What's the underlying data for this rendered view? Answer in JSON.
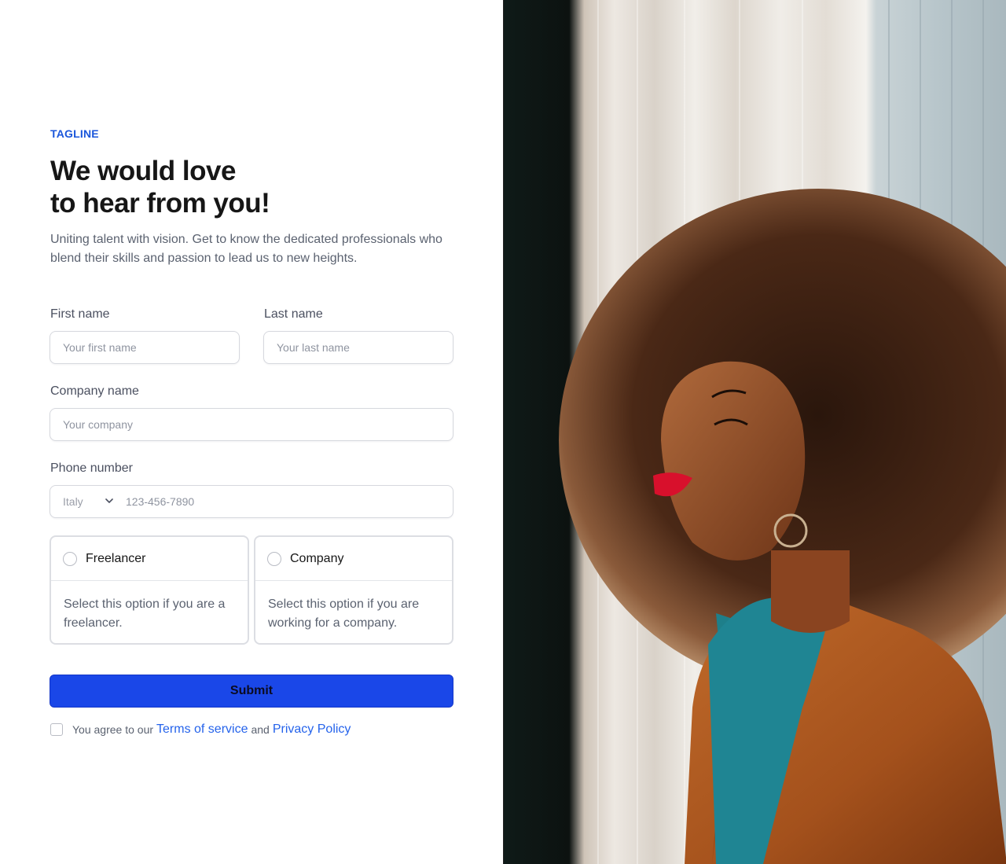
{
  "colors": {
    "accent": "#1a56db",
    "button": "#1a47e8",
    "link": "#2563eb"
  },
  "hero": {
    "tagline": "TAGLINE",
    "title_line1": "We would love",
    "title_line2": "to hear from you!",
    "subtitle": "Uniting talent with vision. Get to know the dedicated professionals who blend their skills and passion to lead us to new heights."
  },
  "form": {
    "first_name": {
      "label": "First name",
      "placeholder": "Your first name",
      "value": ""
    },
    "last_name": {
      "label": "Last name",
      "placeholder": "Your last name",
      "value": ""
    },
    "company": {
      "label": "Company name",
      "placeholder": "Your company",
      "value": ""
    },
    "phone": {
      "label": "Phone number",
      "country": "Italy",
      "placeholder": "123-456-7890",
      "value": ""
    },
    "options": [
      {
        "name": "Freelancer",
        "description": "Select this option if you are a freelancer.",
        "selected": false
      },
      {
        "name": "Company",
        "description": "Select this option if you are working for a company.",
        "selected": false
      }
    ],
    "submit_label": "Submit",
    "agree": {
      "prefix": "You agree to our",
      "terms": "Terms of service",
      "and": "and",
      "privacy": "Privacy Policy",
      "checked": false
    }
  },
  "image": {
    "subject": "woman-portrait-photo"
  }
}
